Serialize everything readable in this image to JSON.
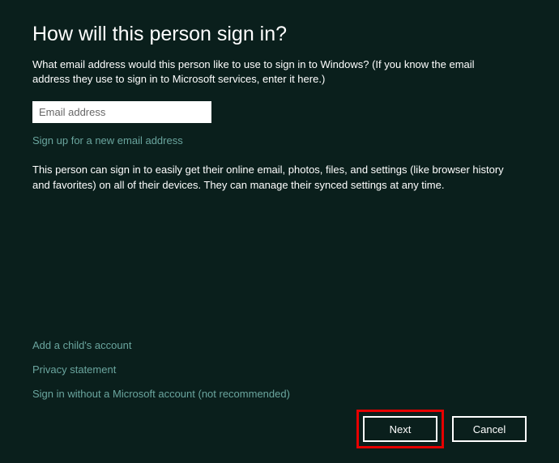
{
  "title": "How will this person sign in?",
  "subtitle": "What email address would this person like to use to sign in to Windows? (If you know the email address they use to sign in to Microsoft services, enter it here.)",
  "email_placeholder": "Email address",
  "email_value": "",
  "signup_link": "Sign up for a new email address",
  "description": "This person can sign in to easily get their online email, photos, files, and settings (like browser history and favorites) on all of their devices. They can manage their synced settings at any time.",
  "links": {
    "child_account": "Add a child's account",
    "privacy": "Privacy statement",
    "no_msaccount": "Sign in without a Microsoft account (not recommended)"
  },
  "buttons": {
    "next": "Next",
    "cancel": "Cancel"
  }
}
